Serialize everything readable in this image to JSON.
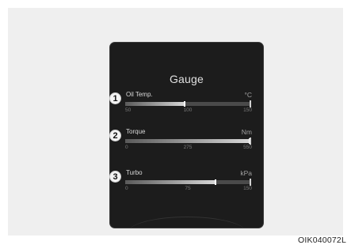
{
  "screen": {
    "title": "Gauge"
  },
  "gauges": [
    {
      "callout": "1",
      "label": "Oil Temp.",
      "unit": "°C",
      "ticks": [
        "50",
        "100",
        "150"
      ],
      "fraction": 0.48
    },
    {
      "callout": "2",
      "label": "Torque",
      "unit": "Nm",
      "ticks": [
        "0",
        "275",
        "550"
      ],
      "fraction": 1.0
    },
    {
      "callout": "3",
      "label": "Turbo",
      "unit": "kPa",
      "ticks": [
        "0",
        "75",
        "150"
      ],
      "fraction": 0.73
    }
  ],
  "figure_code": "OIK040072L"
}
